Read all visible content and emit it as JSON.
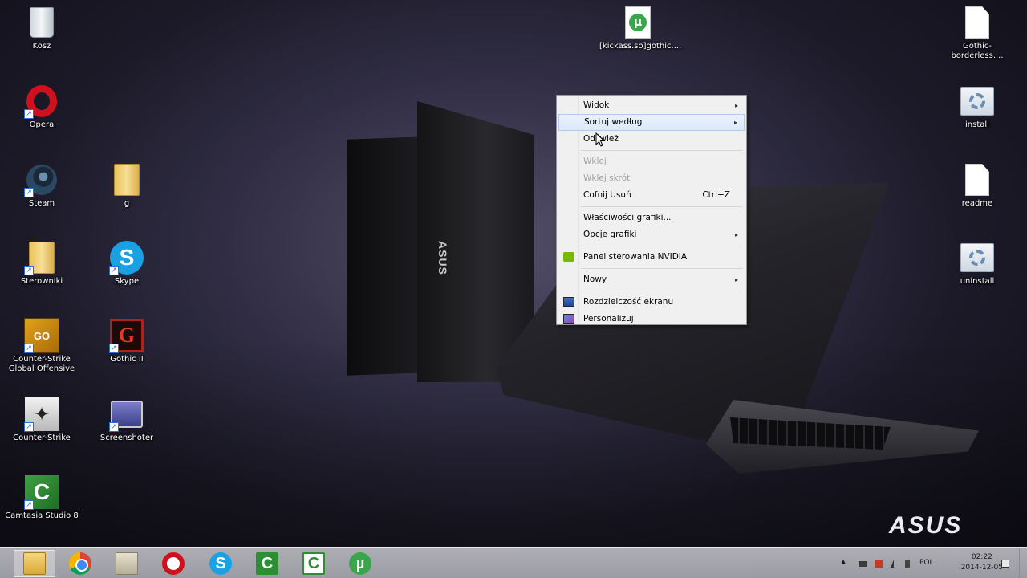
{
  "desktop": {
    "icons": [
      {
        "label": "Kosz",
        "icon": "recycle-bin-icon"
      },
      {
        "label": "Opera",
        "icon": "opera-icon"
      },
      {
        "label": "Steam",
        "icon": "steam-icon"
      },
      {
        "label": "g",
        "icon": "folder-icon"
      },
      {
        "label": "Sterowniki",
        "icon": "folder-icon"
      },
      {
        "label": "Skype",
        "icon": "skype-icon"
      },
      {
        "label": "Counter-Strike Global Offensive",
        "icon": "csgo-icon"
      },
      {
        "label": "Gothic II",
        "icon": "gothic-icon"
      },
      {
        "label": "Counter-Strike",
        "icon": "counter-strike-icon"
      },
      {
        "label": "Screenshoter",
        "icon": "screenshoter-icon"
      },
      {
        "label": "Camtasia Studio 8",
        "icon": "camtasia-icon"
      },
      {
        "label": "[kickass.so]gothic....",
        "icon": "torrent-file-icon"
      },
      {
        "label": "Gothic-borderless....",
        "icon": "document-icon"
      },
      {
        "label": "install",
        "icon": "setup-icon"
      },
      {
        "label": "readme",
        "icon": "document-icon"
      },
      {
        "label": "uninstall",
        "icon": "setup-icon"
      }
    ],
    "wallpaper_brand": "ASUS"
  },
  "context_menu": {
    "items": [
      {
        "label": "Widok",
        "submenu": true,
        "enabled": true
      },
      {
        "label": "Sortuj według",
        "submenu": true,
        "enabled": true,
        "highlighted": true
      },
      {
        "label": "Odśwież",
        "enabled": true
      },
      {
        "label": "Wklej",
        "enabled": false
      },
      {
        "label": "Wklej skrót",
        "enabled": false
      },
      {
        "label": "Cofnij Usuń",
        "shortcut": "Ctrl+Z",
        "enabled": true
      },
      {
        "label": "Właściwości grafiki...",
        "enabled": true
      },
      {
        "label": "Opcje grafiki",
        "submenu": true,
        "enabled": true
      },
      {
        "label": "Panel sterowania NVIDIA",
        "enabled": true,
        "icon": "nvidia-icon"
      },
      {
        "label": "Nowy",
        "submenu": true,
        "enabled": true
      },
      {
        "label": "Rozdzielczość ekranu",
        "enabled": true,
        "icon": "display-icon"
      },
      {
        "label": "Personalizuj",
        "enabled": true,
        "icon": "personalize-icon"
      }
    ],
    "submenu_arrow": "▸"
  },
  "taskbar": {
    "pinned": [
      {
        "name": "file-explorer",
        "glyph": ""
      },
      {
        "name": "chrome",
        "glyph": ""
      },
      {
        "name": "files",
        "glyph": ""
      },
      {
        "name": "opera",
        "glyph": ""
      },
      {
        "name": "skype",
        "glyph": "S"
      },
      {
        "name": "camtasia",
        "glyph": "C"
      },
      {
        "name": "camtasia-recorder",
        "glyph": "C"
      },
      {
        "name": "utorrent",
        "glyph": "µ"
      }
    ],
    "tray": {
      "language": "POL",
      "time": "02:22",
      "date": "2014-12-05",
      "show_hidden": "▲"
    }
  }
}
